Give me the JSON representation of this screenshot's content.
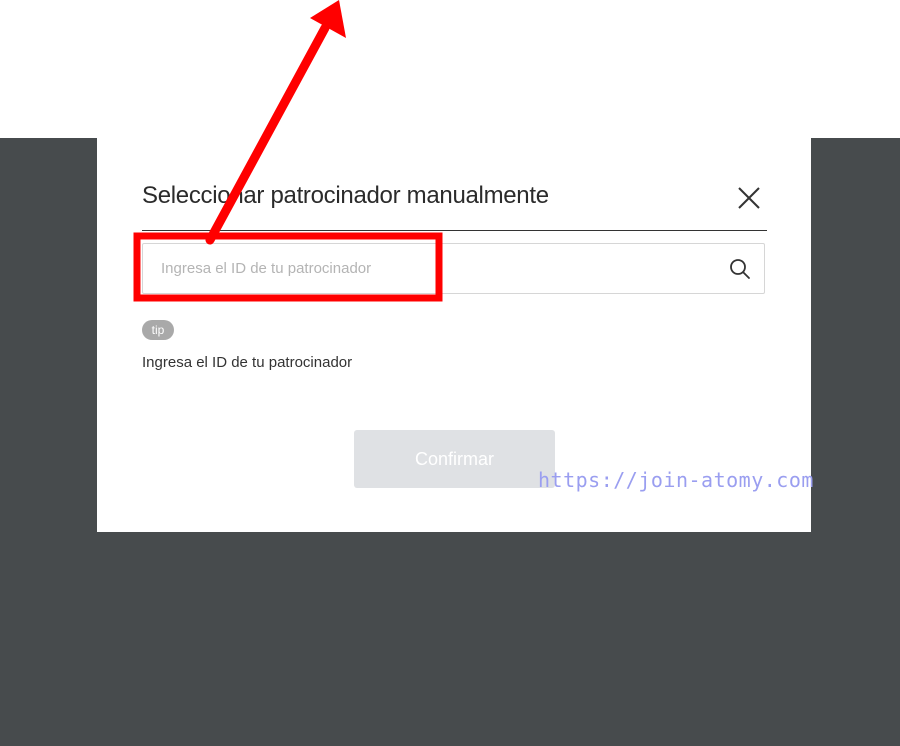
{
  "modal": {
    "title": "Seleccionar patrocinador manualmente",
    "search": {
      "placeholder": "Ingresa el ID de tu patrocinador",
      "value": ""
    },
    "tip_badge": "tip",
    "tip_text": "Ingresa el ID de tu patrocinador",
    "confirm_label": "Confirmar"
  },
  "watermark": "https://join-atomy.com",
  "icons": {
    "close": "close-icon",
    "search": "search-icon"
  },
  "colors": {
    "overlay": "#474b4d",
    "annotation": "#ff0000",
    "confirm_disabled": "#dfe1e4",
    "watermark": "#9a9ef0"
  }
}
